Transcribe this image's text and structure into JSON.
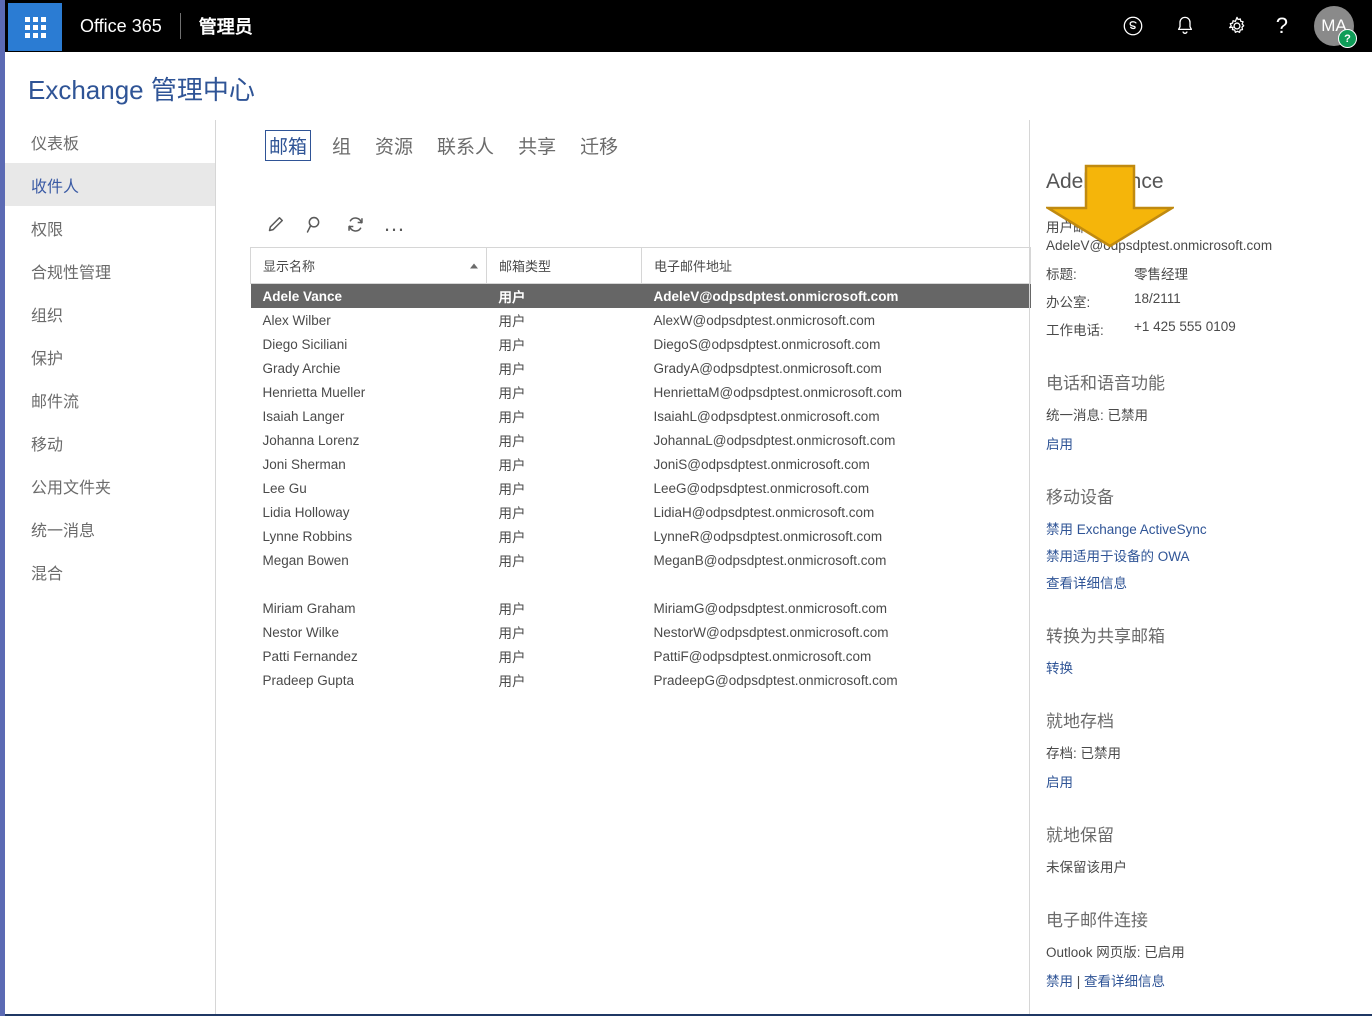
{
  "suite": {
    "waffle_label": "app-launcher",
    "brand": "Office 365",
    "subtitle": "管理员",
    "icons": {
      "skype": "skype-icon",
      "bell": "notifications-icon",
      "gear": "settings-icon",
      "help": "?"
    },
    "avatar": {
      "initials": "MA",
      "badge": "?"
    }
  },
  "page": {
    "title": "Exchange 管理中心"
  },
  "sidebar": {
    "items": [
      {
        "label": "仪表板",
        "active": false
      },
      {
        "label": "收件人",
        "active": true
      },
      {
        "label": "权限",
        "active": false
      },
      {
        "label": "合规性管理",
        "active": false
      },
      {
        "label": "组织",
        "active": false
      },
      {
        "label": "保护",
        "active": false
      },
      {
        "label": "邮件流",
        "active": false
      },
      {
        "label": "移动",
        "active": false
      },
      {
        "label": "公用文件夹",
        "active": false
      },
      {
        "label": "统一消息",
        "active": false
      },
      {
        "label": "混合",
        "active": false
      }
    ]
  },
  "tabs": [
    {
      "label": "邮箱",
      "active": true
    },
    {
      "label": "组",
      "active": false
    },
    {
      "label": "资源",
      "active": false
    },
    {
      "label": "联系人",
      "active": false
    },
    {
      "label": "共享",
      "active": false
    },
    {
      "label": "迁移",
      "active": false
    }
  ],
  "toolbar": {
    "edit": "edit-pencil-icon",
    "search": "search-icon",
    "refresh": "refresh-icon",
    "more": "…"
  },
  "table": {
    "columns": [
      "显示名称",
      "邮箱类型",
      "电子邮件地址"
    ],
    "sort_column": "显示名称",
    "sort_direction": "ascending",
    "rows": [
      {
        "name": "Adele Vance",
        "type": "用户",
        "email": "AdeleV@odpsdptest.onmicrosoft.com",
        "selected": true,
        "spacer_after": false
      },
      {
        "name": "Alex Wilber",
        "type": "用户",
        "email": "AlexW@odpsdptest.onmicrosoft.com",
        "selected": false,
        "spacer_after": false
      },
      {
        "name": "Diego Siciliani",
        "type": "用户",
        "email": "DiegoS@odpsdptest.onmicrosoft.com",
        "selected": false,
        "spacer_after": false
      },
      {
        "name": "Grady Archie",
        "type": "用户",
        "email": "GradyA@odpsdptest.onmicrosoft.com",
        "selected": false,
        "spacer_after": false
      },
      {
        "name": "Henrietta Mueller",
        "type": "用户",
        "email": "HenriettaM@odpsdptest.onmicrosoft.com",
        "selected": false,
        "spacer_after": false
      },
      {
        "name": "Isaiah Langer",
        "type": "用户",
        "email": "IsaiahL@odpsdptest.onmicrosoft.com",
        "selected": false,
        "spacer_after": false
      },
      {
        "name": "Johanna Lorenz",
        "type": "用户",
        "email": "JohannaL@odpsdptest.onmicrosoft.com",
        "selected": false,
        "spacer_after": false
      },
      {
        "name": "Joni Sherman",
        "type": "用户",
        "email": "JoniS@odpsdptest.onmicrosoft.com",
        "selected": false,
        "spacer_after": false
      },
      {
        "name": "Lee Gu",
        "type": "用户",
        "email": "LeeG@odpsdptest.onmicrosoft.com",
        "selected": false,
        "spacer_after": false
      },
      {
        "name": "Lidia Holloway",
        "type": "用户",
        "email": "LidiaH@odpsdptest.onmicrosoft.com",
        "selected": false,
        "spacer_after": false
      },
      {
        "name": "Lynne Robbins",
        "type": "用户",
        "email": "LynneR@odpsdptest.onmicrosoft.com",
        "selected": false,
        "spacer_after": false
      },
      {
        "name": "Megan Bowen",
        "type": "用户",
        "email": "MeganB@odpsdptest.onmicrosoft.com",
        "selected": false,
        "spacer_after": true
      },
      {
        "name": "Miriam Graham",
        "type": "用户",
        "email": "MiriamG@odpsdptest.onmicrosoft.com",
        "selected": false,
        "spacer_after": false
      },
      {
        "name": "Nestor Wilke",
        "type": "用户",
        "email": "NestorW@odpsdptest.onmicrosoft.com",
        "selected": false,
        "spacer_after": false
      },
      {
        "name": "Patti Fernandez",
        "type": "用户",
        "email": "PattiF@odpsdptest.onmicrosoft.com",
        "selected": false,
        "spacer_after": false
      },
      {
        "name": "Pradeep Gupta",
        "type": "用户",
        "email": "PradeepG@odpsdptest.onmicrosoft.com",
        "selected": false,
        "spacer_after": false
      }
    ]
  },
  "detail": {
    "title": "Adele Vance",
    "mailbox_type": "用户邮箱",
    "email": "AdeleV@odpsdptest.onmicrosoft.com",
    "fields": [
      {
        "label": "标题:",
        "value": "零售经理"
      },
      {
        "label": "办公室:",
        "value": "18/2111"
      },
      {
        "label": "工作电话:",
        "value": "+1 425 555 0109"
      }
    ],
    "sections": {
      "phone_voice": {
        "heading": "电话和语音功能",
        "status": "统一消息: 已禁用",
        "link": "启用"
      },
      "mobile": {
        "heading": "移动设备",
        "links": [
          "禁用 Exchange ActiveSync",
          "禁用适用于设备的 OWA",
          "查看详细信息"
        ]
      },
      "shared": {
        "heading": "转换为共享邮箱",
        "link": "转换"
      },
      "archive": {
        "heading": "就地存档",
        "status": "存档: 已禁用",
        "link": "启用"
      },
      "hold": {
        "heading": "就地保留",
        "status": "未保留该用户"
      },
      "email_connectivity": {
        "heading": "电子邮件连接",
        "status": "Outlook 网页版: 已启用",
        "link_disable": "禁用",
        "link_separator": " | ",
        "link_details": "查看详细信息"
      }
    }
  },
  "annotation": {
    "type": "down-arrow",
    "fill": "#f5b50a",
    "stroke": "#c08a10"
  },
  "colors": {
    "accent_blue": "#2f5496",
    "rail": "#5b6ab4",
    "waffle_blue": "#2b7cd3",
    "selected_row": "#666666",
    "sidebar_active_bg": "#e8e8e8"
  }
}
